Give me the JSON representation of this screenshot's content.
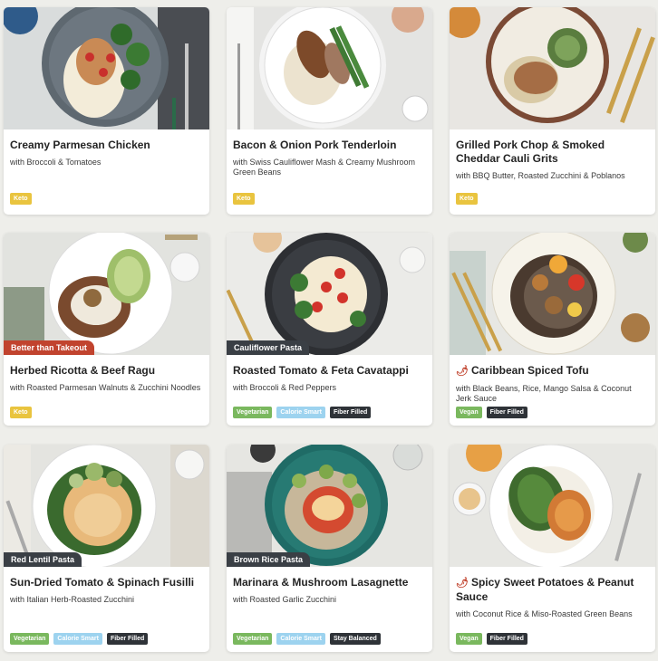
{
  "colors": {
    "card_background": "#ffffff",
    "page_background": "#eeeeea",
    "keto": "#e9c43f",
    "vegetarian": "#7ab85e",
    "calorie_smart": "#9dd3ef",
    "dark_tag": "#2f3338",
    "ribbon_red": "#c1432e",
    "ribbon_dark": "#3a3f45"
  },
  "recipes": [
    {
      "title": "Creamy Parmesan Chicken",
      "subtitle": "with Broccoli & Tomatoes",
      "ribbon": "",
      "spicy": false,
      "tags": [
        "Keto"
      ]
    },
    {
      "title": "Bacon & Onion Pork Tenderloin",
      "subtitle": "with Swiss Cauliflower Mash & Creamy Mushroom Green Beans",
      "ribbon": "",
      "spicy": false,
      "tags": [
        "Keto"
      ]
    },
    {
      "title": "Grilled Pork Chop & Smoked Cheddar Cauli Grits",
      "subtitle": "with BBQ Butter, Roasted Zucchini & Poblanos",
      "ribbon": "",
      "spicy": false,
      "tags": [
        "Keto"
      ]
    },
    {
      "title": "Herbed Ricotta & Beef Ragu",
      "subtitle": "with Roasted Parmesan Walnuts & Zucchini Noodles",
      "ribbon": "Better than Takeout",
      "spicy": false,
      "tags": [
        "Keto"
      ]
    },
    {
      "title": "Roasted Tomato & Feta Cavatappi",
      "subtitle": "with Broccoli & Red Peppers",
      "ribbon": "Cauliflower Pasta",
      "spicy": false,
      "tags": [
        "Vegetarian",
        "Calorie Smart",
        "Fiber Filled"
      ]
    },
    {
      "title": "Caribbean Spiced Tofu",
      "subtitle": "with Black Beans, Rice, Mango Salsa & Coconut Jerk Sauce",
      "ribbon": "",
      "spicy": true,
      "tags": [
        "Vegan",
        "Fiber Filled"
      ]
    },
    {
      "title": "Sun-Dried Tomato & Spinach Fusilli",
      "subtitle": "with Italian Herb-Roasted Zucchini",
      "ribbon": "Red Lentil Pasta",
      "spicy": false,
      "tags": [
        "Vegetarian",
        "Calorie Smart",
        "Fiber Filled"
      ]
    },
    {
      "title": "Marinara & Mushroom Lasagnette",
      "subtitle": "with Roasted Garlic Zucchini",
      "ribbon": "Brown Rice Pasta",
      "spicy": false,
      "tags": [
        "Vegetarian",
        "Calorie Smart",
        "Stay Balanced"
      ]
    },
    {
      "title": "Spicy Sweet Potatoes & Peanut Sauce",
      "subtitle": "with Coconut Rice & Miso-Roasted Green Beans",
      "ribbon": "",
      "spicy": true,
      "tags": [
        "Vegan",
        "Fiber Filled"
      ]
    }
  ]
}
